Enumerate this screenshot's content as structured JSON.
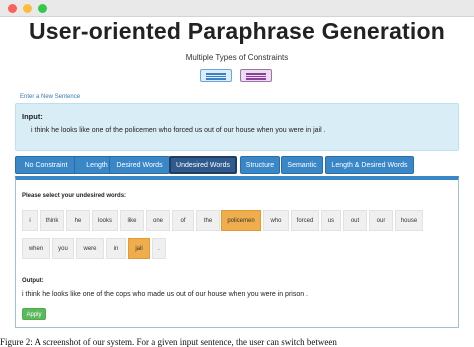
{
  "window": {
    "controls": [
      "close",
      "minimize",
      "zoom"
    ]
  },
  "header": {
    "title": "User-oriented Paraphrase Generation",
    "subtitle": "Multiple Types of Constraints",
    "mode_buttons": [
      {
        "icon": "lines-icon",
        "color": "#3b7fc4"
      },
      {
        "icon": "lines-icon",
        "color": "#8b3f9a"
      }
    ]
  },
  "enter_link": "Enter a New Sentence",
  "input": {
    "label": "Input:",
    "text": "i think he looks like one of the policemen who forced us out of our house when you were in jail ."
  },
  "tabs": [
    {
      "label": "No Constraint",
      "active": false
    },
    {
      "label": "Length",
      "active": false
    },
    {
      "label": "Desired Words",
      "active": false
    },
    {
      "label": "Undesired Words",
      "active": true
    },
    {
      "label": "Structure",
      "active": false
    },
    {
      "label": "Semantic",
      "active": false
    },
    {
      "label": "Length & Desired Words",
      "active": false
    }
  ],
  "panel": {
    "instruction": "Please select your undesired words:",
    "words": [
      {
        "text": "i",
        "selected": false
      },
      {
        "text": "think",
        "selected": false
      },
      {
        "text": "he",
        "selected": false
      },
      {
        "text": "looks",
        "selected": false
      },
      {
        "text": "like",
        "selected": false
      },
      {
        "text": "one",
        "selected": false
      },
      {
        "text": "of",
        "selected": false
      },
      {
        "text": "the",
        "selected": false
      },
      {
        "text": "policemen",
        "selected": true
      },
      {
        "text": "who",
        "selected": false
      },
      {
        "text": "forced",
        "selected": false
      },
      {
        "text": "us",
        "selected": false
      },
      {
        "text": "out",
        "selected": false
      },
      {
        "text": "our",
        "selected": false
      },
      {
        "text": "house",
        "selected": false
      },
      {
        "text": "when",
        "selected": false
      },
      {
        "text": "you",
        "selected": false
      },
      {
        "text": "were",
        "selected": false
      },
      {
        "text": "in",
        "selected": false
      },
      {
        "text": "jail",
        "selected": true
      },
      {
        "text": ".",
        "selected": false
      }
    ],
    "output_label": "Output:",
    "output_text": "i think he looks like one of the cops who made us out of our house when you were in prison .",
    "apply_label": "Apply"
  },
  "colors": {
    "tab": "#3a87c8",
    "tab_active": "#2f5a8b",
    "selected_word": "#f0ad4e",
    "input_bg": "#d9edf7",
    "apply": "#5cb85c"
  },
  "caption": "Figure 2: A screenshot of our system. For a given input sentence, the user can switch between"
}
